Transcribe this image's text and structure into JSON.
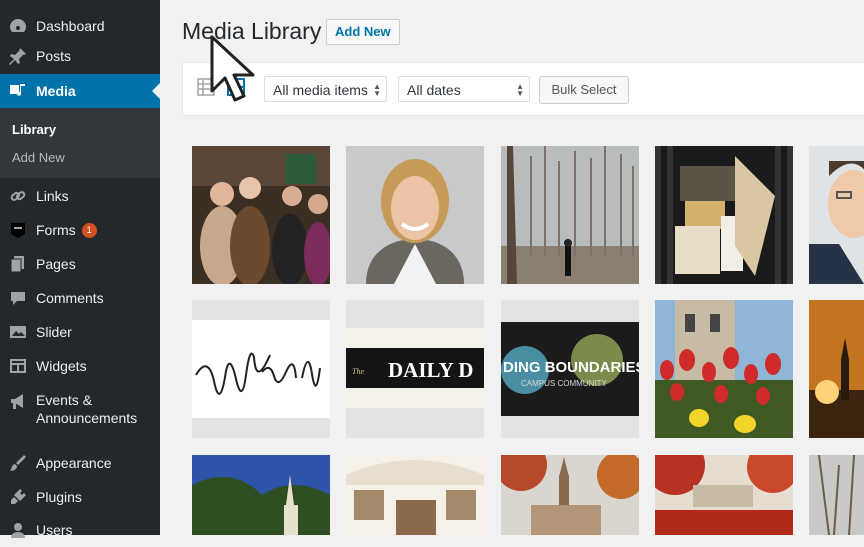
{
  "sidebar": {
    "items": [
      {
        "label": "Dashboard",
        "icon": "dashboard-icon"
      },
      {
        "label": "Posts",
        "icon": "pin-icon"
      },
      {
        "label": "Media",
        "icon": "media-icon"
      },
      {
        "label": "Links",
        "icon": "link-icon"
      },
      {
        "label": "Forms",
        "icon": "forms-icon",
        "badge": "1"
      },
      {
        "label": "Pages",
        "icon": "pages-icon"
      },
      {
        "label": "Comments",
        "icon": "comment-icon"
      },
      {
        "label": "Slider",
        "icon": "slider-icon"
      },
      {
        "label": "Widgets",
        "icon": "widgets-icon"
      },
      {
        "label": "Events & Announcements",
        "icon": "megaphone-icon"
      },
      {
        "label": "Appearance",
        "icon": "brush-icon"
      },
      {
        "label": "Plugins",
        "icon": "plugin-icon"
      },
      {
        "label": "Users",
        "icon": "user-icon"
      }
    ],
    "submenu": [
      "Library",
      "Add New"
    ]
  },
  "header": {
    "title": "Media Library",
    "add_new": "Add New"
  },
  "toolbar": {
    "media_filter": "All media items",
    "date_filter": "All dates",
    "bulk_select": "Bulk Select"
  },
  "colors": {
    "sidebar_bg": "#23282d",
    "active_accent": "#0073aa",
    "badge": "#d54e21"
  }
}
